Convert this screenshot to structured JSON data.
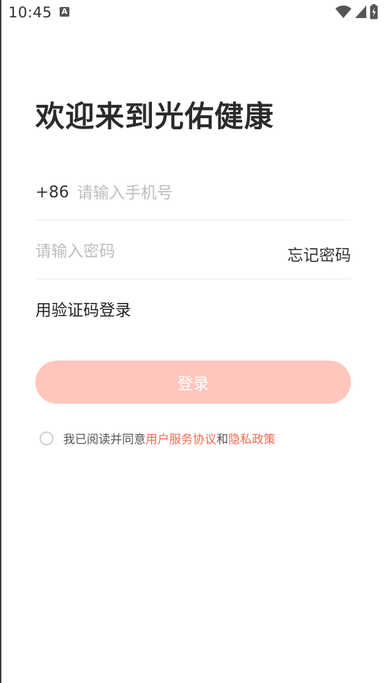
{
  "status_bar": {
    "time": "10:45",
    "notification_icon_letter": "A"
  },
  "login": {
    "title": "欢迎来到光佑健康",
    "country_code": "+86",
    "phone_placeholder": "请输入手机号",
    "password_placeholder": "请输入密码",
    "forgot_password": "忘记密码",
    "sms_login": "用验证码登录",
    "login_button": "登录"
  },
  "agreement": {
    "prefix": "我已阅读并同意",
    "user_agreement": "用户服务协议",
    "conjunction": "和",
    "privacy_policy": "隐私政策"
  },
  "colors": {
    "button_bg": "#ffc6bd",
    "link": "#f26a4f",
    "placeholder": "#bdbdbd"
  }
}
